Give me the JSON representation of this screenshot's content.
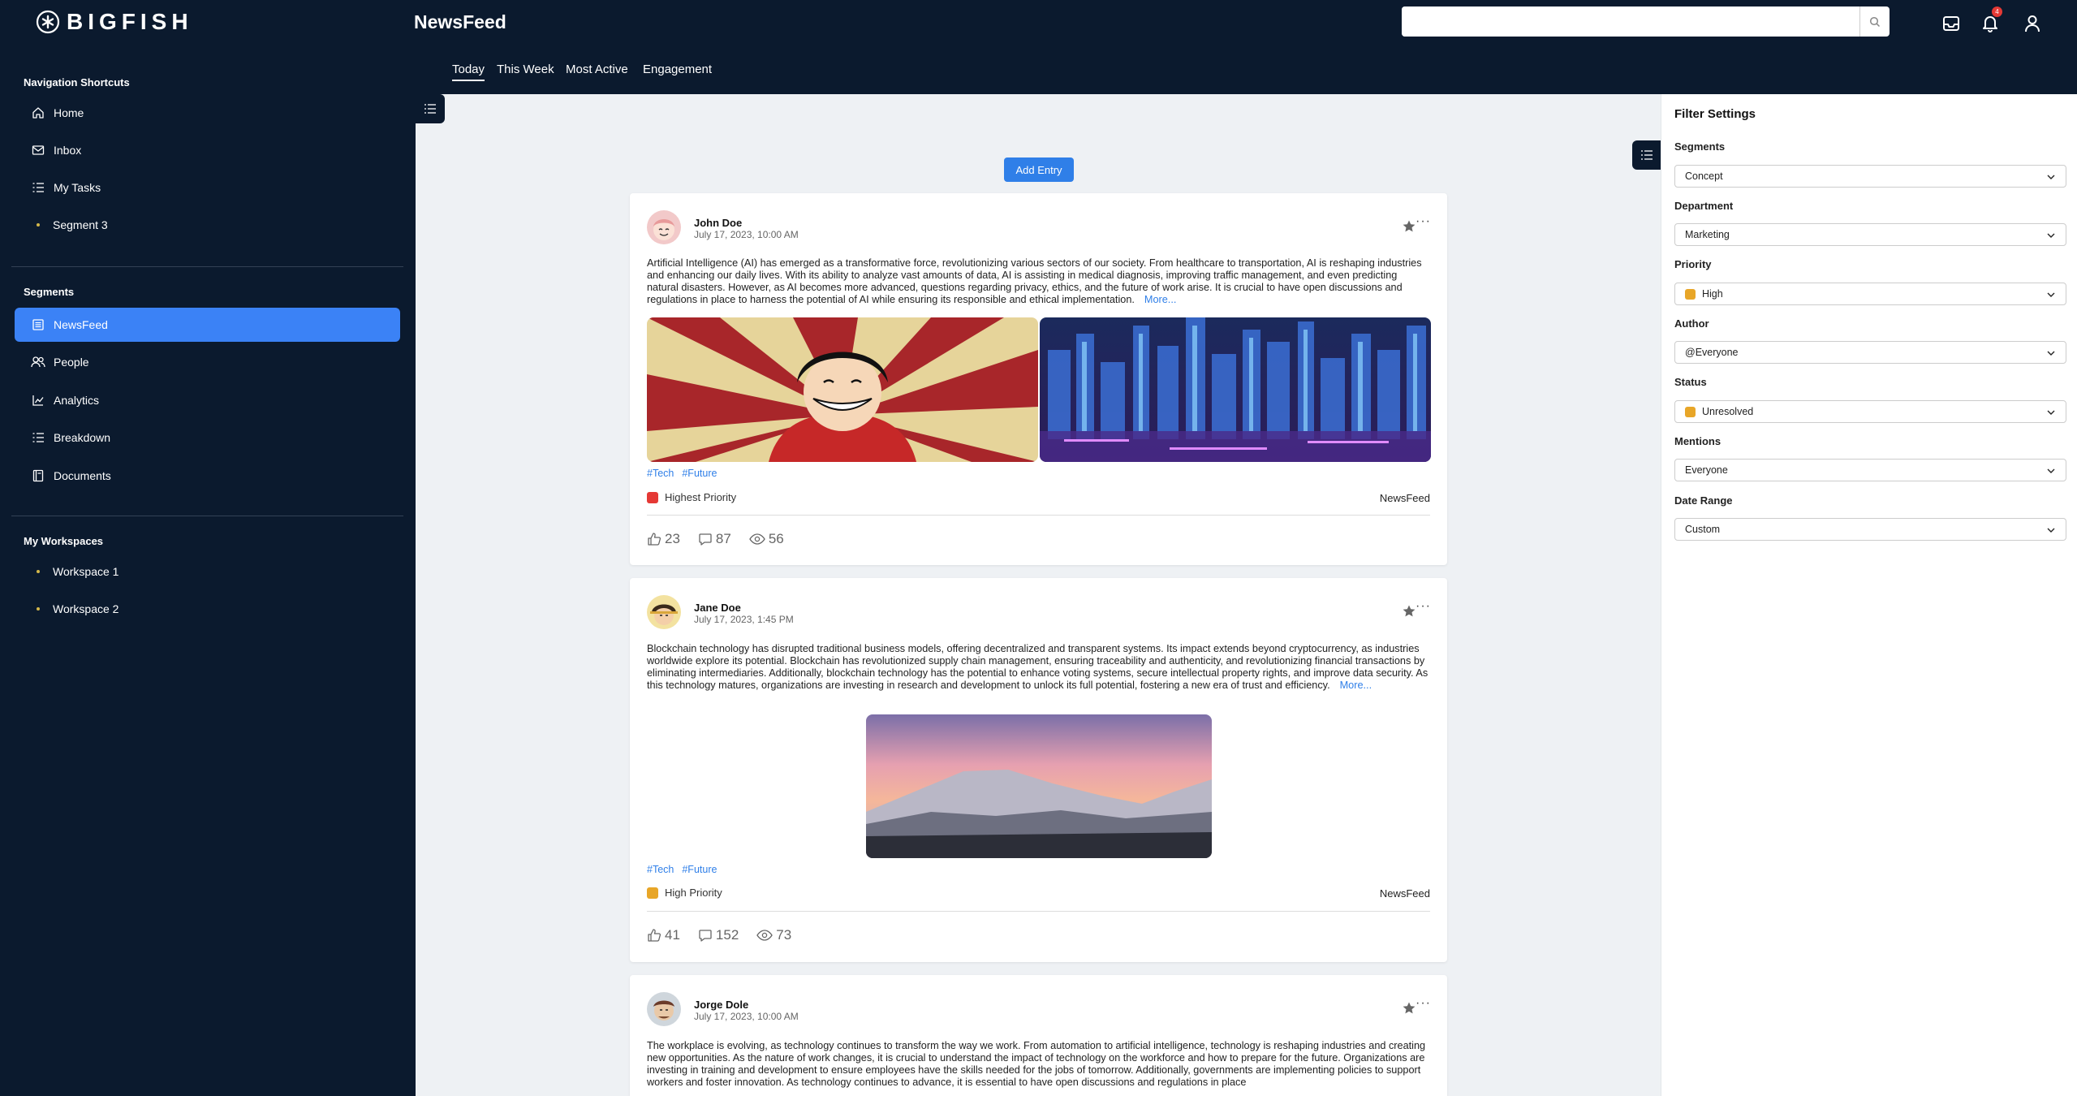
{
  "app": {
    "brand": "BIGFISH",
    "page_title": "NewsFeed"
  },
  "topbar": {
    "search_placeholder": "",
    "notification_count": "4"
  },
  "sidebar": {
    "shortcuts_title": "Navigation Shortcuts",
    "shortcuts": [
      {
        "label": "Home",
        "icon": "home-icon"
      },
      {
        "label": "Inbox",
        "icon": "mail-icon"
      },
      {
        "label": "My Tasks",
        "icon": "list-icon"
      },
      {
        "label": "Segment 3",
        "icon": "dot"
      }
    ],
    "segments_title": "Segments",
    "segments": [
      {
        "label": "NewsFeed",
        "icon": "newspaper-icon",
        "active": true
      },
      {
        "label": "People",
        "icon": "people-icon"
      },
      {
        "label": "Analytics",
        "icon": "chart-icon"
      },
      {
        "label": "Breakdown",
        "icon": "list-icon"
      },
      {
        "label": "Documents",
        "icon": "document-icon"
      }
    ],
    "workspaces_title": "My Workspaces",
    "workspaces": [
      {
        "label": "Workspace 1"
      },
      {
        "label": "Workspace 2"
      }
    ]
  },
  "tabs": [
    {
      "label": "Today",
      "active": true
    },
    {
      "label": "This Week"
    },
    {
      "label": "Most Active"
    },
    {
      "label": "Engagement"
    }
  ],
  "feed": {
    "add_entry": "Add Entry",
    "posts": [
      {
        "author": "John Doe",
        "date": "July 17, 2023, 10:00 AM",
        "text": "Artificial Intelligence (AI) has emerged as a transformative force, revolutionizing various sectors of our society. From healthcare to transportation, AI is reshaping industries and enhancing our daily lives. With its ability to analyze vast amounts of data, AI is assisting in medical diagnosis, improving traffic management, and even predicting natural disasters. However, as AI becomes more advanced, questions regarding privacy, ethics, and the future of work arise. It is crucial to have open discussions and regulations in place to harness the potential of AI while ensuring its responsible and ethical implementation.",
        "more": "More...",
        "tags": [
          "#Tech",
          "#Future"
        ],
        "priority": "Highest Priority",
        "priority_color": "#e53935",
        "section": "NewsFeed",
        "likes": "23",
        "comments": "87",
        "views": "56"
      },
      {
        "author": "Jane Doe",
        "date": "July 17, 2023, 1:45 PM",
        "text": "Blockchain technology has disrupted traditional business models, offering decentralized and transparent systems. Its impact extends beyond cryptocurrency, as industries worldwide explore its potential. Blockchain has revolutionized supply chain management, ensuring traceability and authenticity, and revolutionizing financial transactions by eliminating intermediaries. Additionally, blockchain technology has the potential to enhance voting systems, secure intellectual property rights, and improve data security. As this technology matures, organizations are investing in research and development to unlock its full potential, fostering a new era of trust and efficiency.",
        "more": "More...",
        "tags": [
          "#Tech",
          "#Future"
        ],
        "priority": "High Priority",
        "priority_color": "#e8a628",
        "section": "NewsFeed",
        "likes": "41",
        "comments": "152",
        "views": "73"
      },
      {
        "author": "Jorge Dole",
        "date": "July 17, 2023, 10:00 AM",
        "text": "The workplace is evolving, as technology continues to transform the way we work. From automation to artificial intelligence, technology is reshaping industries and creating new opportunities. As the nature of work changes, it is crucial to understand the impact of technology on the workforce and how to prepare for the future. Organizations are investing in training and development to ensure employees have the skills needed for the jobs of tomorrow. Additionally, governments are implementing policies to support workers and foster innovation. As technology continues to advance, it is essential to have open discussions and regulations in place"
      }
    ]
  },
  "filters": {
    "title": "Filter Settings",
    "items": [
      {
        "label": "Segments",
        "value": "Concept"
      },
      {
        "label": "Department",
        "value": "Marketing"
      },
      {
        "label": "Priority",
        "value": "High",
        "swatch": "#e8a628"
      },
      {
        "label": "Author",
        "value": "@Everyone"
      },
      {
        "label": "Status",
        "value": "Unresolved",
        "swatch": "#e8a628"
      },
      {
        "label": "Mentions",
        "value": "Everyone"
      },
      {
        "label": "Date Range",
        "value": "Custom"
      }
    ]
  }
}
